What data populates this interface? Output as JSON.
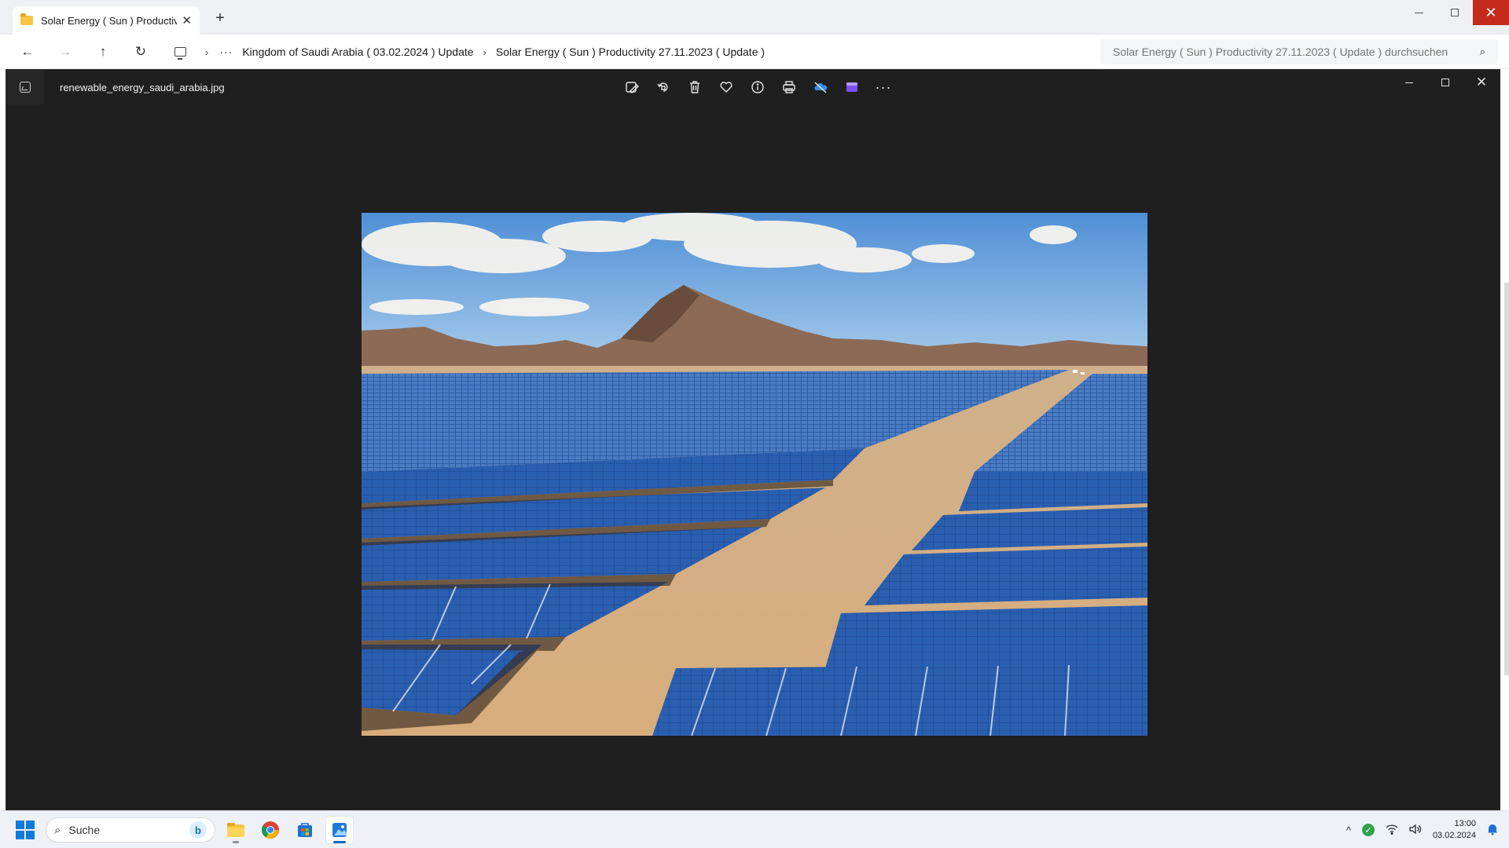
{
  "explorer": {
    "tab_title": "Solar Energy ( Sun ) Productivi",
    "tab_close": "✕",
    "new_tab": "+",
    "nav": {
      "back": "←",
      "forward": "→",
      "up": "↑",
      "refresh": "↻"
    },
    "breadcrumb": {
      "overflow": "···",
      "separator": "›",
      "items": [
        "Kingdom of Saudi Arabia ( 03.02.2024 ) Update",
        "Solar Energy ( Sun ) Productivity 27.11.2023 ( Update )"
      ]
    },
    "search_placeholder": "Solar Energy ( Sun ) Productivity 27.11.2023 ( Update ) durchsuchen",
    "window_close": "✕"
  },
  "photos": {
    "filename": "renewable_energy_saudi_arabia.jpg",
    "toolbar_icons": [
      "edit-image-icon",
      "rotate-icon",
      "delete-icon",
      "favorite-icon",
      "info-icon",
      "print-icon",
      "onedrive-icon",
      "clipchamp-icon",
      "more-icon"
    ],
    "more_label": "···",
    "window_close": "✕"
  },
  "taskbar": {
    "search_label": "Suche",
    "bing_label": "b",
    "apps": [
      "file-explorer-icon",
      "chrome-icon",
      "store-icon",
      "photos-icon"
    ],
    "tray_chevron": "^",
    "time": "13:00",
    "date": "03.02.2024"
  },
  "colors": {
    "photos_bg": "#1f1f1f",
    "close_red": "#c42b1c",
    "accent": "#0f7bd8",
    "sky": "#5b9bd8",
    "sand": "#d9b489",
    "panel_blue": "#1f4d9a"
  }
}
